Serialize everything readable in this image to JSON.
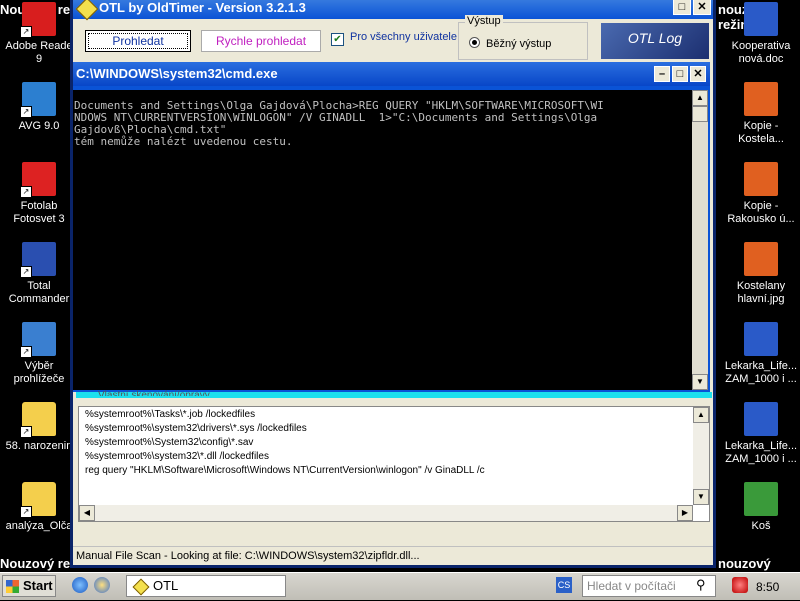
{
  "desktop": {
    "safe_mode_label": "Nouzový režim",
    "safe_mode_label_left_fragment": "Nouzový re",
    "safe_mode_label_right_fragment": "nouzový režim",
    "left_icons": [
      {
        "label": "Adobe Reade\n9",
        "icon": "pdf-icon",
        "color": "#d81e1e"
      },
      {
        "label": "AVG 9.0",
        "icon": "avg-icon",
        "color": "#2c7fd0"
      },
      {
        "label": "Fotolab\nFotosvet 3",
        "icon": "fotolab-icon",
        "color": "#d22"
      },
      {
        "label": "Total\nCommander",
        "icon": "floppy-icon",
        "color": "#2a4fb0"
      },
      {
        "label": "Výběr\nprohlížeče",
        "icon": "checklist-icon",
        "color": "#3a7fd0"
      },
      {
        "label": "58. narozenin",
        "icon": "folder-icon",
        "color": "#f4cf4c"
      },
      {
        "label": "analýza_Olča",
        "icon": "folder-icon",
        "color": "#f4cf4c"
      }
    ],
    "right_icons": [
      {
        "label": "Kooperativa\nnová.doc",
        "icon": "word-doc-icon",
        "color": "#2a5ac8"
      },
      {
        "label": "Kopie -\nKostela...",
        "icon": "image-file-icon",
        "color": "#e06020"
      },
      {
        "label": "Kopie -\nRakousko ú...",
        "icon": "image-file-icon",
        "color": "#e06020"
      },
      {
        "label": "Kostelany\nhlavní.jpg",
        "icon": "image-file-icon",
        "color": "#e06020"
      },
      {
        "label": "Lekarka_Life...\nZAM_1000 i ...",
        "icon": "word-doc-icon",
        "color": "#2a5ac8"
      },
      {
        "label": "Lekarka_Life...\nZAM_1000 i ...",
        "icon": "word-doc-icon",
        "color": "#2a5ac8"
      },
      {
        "label": "Koš",
        "icon": "recycle-bin-icon",
        "color": "#3a9a3a"
      }
    ]
  },
  "otl": {
    "title": "OTL by OldTimer - Version 3.2.1.3",
    "scan_button": "Prohledat",
    "quick_scan_button": "Rychle prohledat",
    "all_users_checkbox": "Pro všechny uživatele",
    "all_users_checked": true,
    "output_group": "Výstup",
    "output_option": "Běžný výstup",
    "logo_text": "OTL Log Analysis",
    "custom_scan_label": "Vlastní skenování/opravy",
    "custom_scan_lines": [
      "%systemroot%\\Tasks\\*.job /lockedfiles",
      "%systemroot%\\system32\\drivers\\*.sys /lockedfiles",
      "%systemroot%\\System32\\config\\*.sav",
      "%systemroot%\\system32\\*.dll /lockedfiles",
      "reg query \"HKLM\\Software\\Microsoft\\Windows NT\\CurrentVersion\\winlogon\" /v GinaDLL /c"
    ],
    "status": "Manual File Scan - Looking at file: C:\\WINDOWS\\system32\\zipfldr.dll..."
  },
  "cmd": {
    "title": "C:\\WINDOWS\\system32\\cmd.exe",
    "lines": [
      "Documents and Settings\\Olga Gajdová\\Plocha>REG QUERY \"HKLM\\SOFTWARE\\MICROSOFT\\WI",
      "NDOWS NT\\CURRENTVERSION\\WINLOGON\" /V GINADLL  1>\"C:\\Documents and Settings\\Olga",
      "Gajdovß\\Plocha\\cmd.txt\"",
      "tém nemůže nalézt uvedenou cestu."
    ]
  },
  "taskbar": {
    "start_label": "Start",
    "task_label": "OTL",
    "search_placeholder": "Hledat v počítači",
    "clock": "8:50"
  }
}
